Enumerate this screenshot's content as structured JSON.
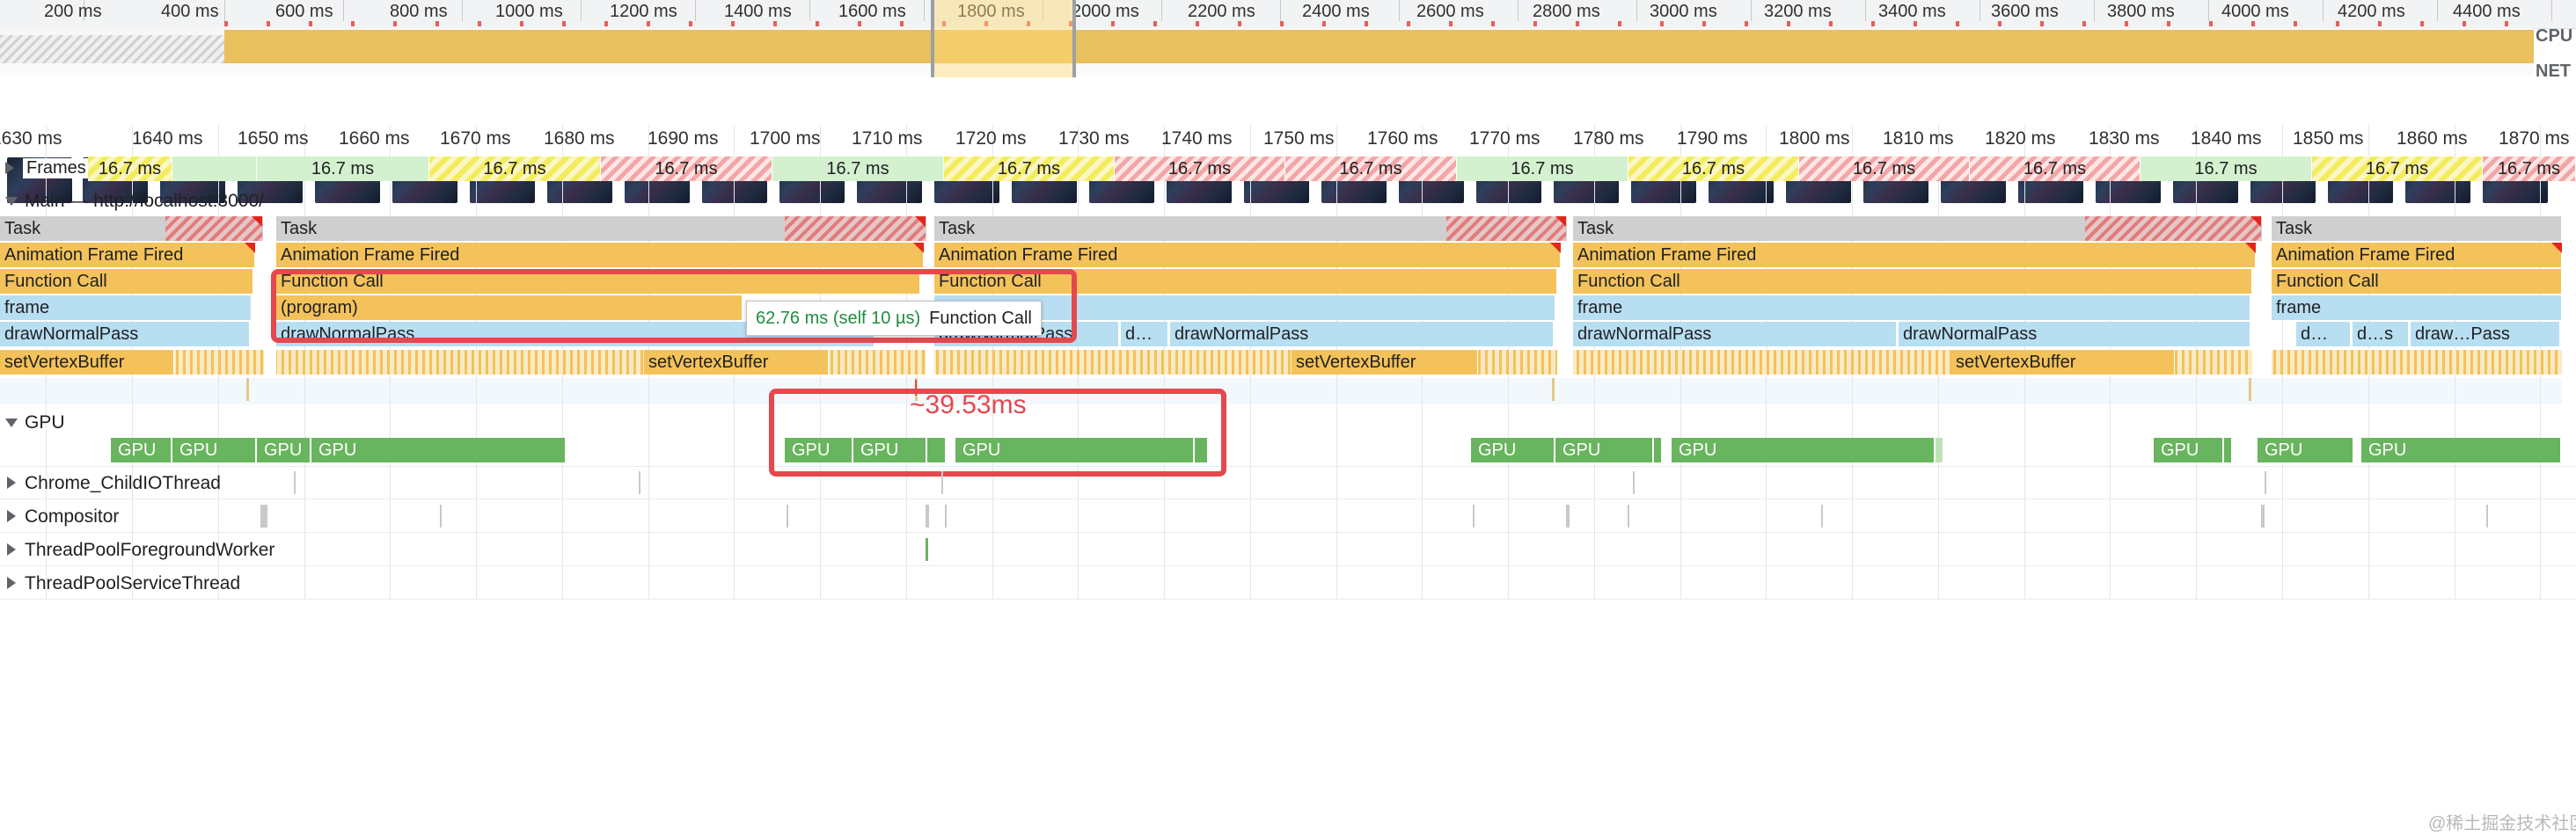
{
  "overview": {
    "ms_labels": [
      "200 ms",
      "400 ms",
      "600 ms",
      "800 ms",
      "1000 ms",
      "1200 ms",
      "1400 ms",
      "1600 ms",
      "1800 ms",
      "2000 ms",
      "2200 ms",
      "2400 ms",
      "2600 ms",
      "2800 ms",
      "3000 ms",
      "3200 ms",
      "3400 ms",
      "3600 ms",
      "3800 ms",
      "4000 ms",
      "4200 ms",
      "4400 ms"
    ],
    "cpu_label": "CPU",
    "net_label": "NET"
  },
  "timeline": {
    "labels": [
      "1630 ms",
      "1640 ms",
      "1650 ms",
      "1660 ms",
      "1670 ms",
      "1680 ms",
      "1690 ms",
      "1700 ms",
      "1710 ms",
      "1720 ms",
      "1730 ms",
      "1740 ms",
      "1750 ms",
      "1760 ms",
      "1770 ms",
      "1780 ms",
      "1790 ms",
      "1800 ms",
      "1810 ms",
      "1820 ms",
      "1830 ms",
      "1840 ms",
      "1850 ms",
      "1860 ms",
      "1870 ms"
    ]
  },
  "frames": {
    "track_label": "Frames",
    "frame_label": "16.7 ms"
  },
  "main": {
    "track_label": "Main — http://localhost:3000/",
    "task": "Task",
    "anim": "Animation Frame Fired",
    "func": "Function Call",
    "frame": "frame",
    "draw": "drawNormalPass",
    "svb": "setVertexBuffer",
    "program": "(program)",
    "d_short": "d…",
    "ds_short": "d…s",
    "draw_short": "draw…Pass",
    "draw_partial": "drawNormalPass"
  },
  "tooltip": {
    "duration": "62.76 ms (self 10 µs)",
    "name": "Function Call"
  },
  "annotation": {
    "gap": "~39.53ms"
  },
  "gpu": {
    "track_label": "GPU",
    "block_label": "GPU"
  },
  "threads": [
    {
      "label": "Chrome_ChildIOThread"
    },
    {
      "label": "Compositor"
    },
    {
      "label": "ThreadPoolForegroundWorker"
    },
    {
      "label": "ThreadPoolServiceThread"
    }
  ],
  "watermark": "@稀土掘金技术社区",
  "colors": {
    "annotation_red": "#e5484d",
    "gpu_green": "#69b45e",
    "scripting_yellow": "#f3c25a",
    "rendering_blue": "#b8def1",
    "tooltip_green": "#1e8e3e"
  }
}
